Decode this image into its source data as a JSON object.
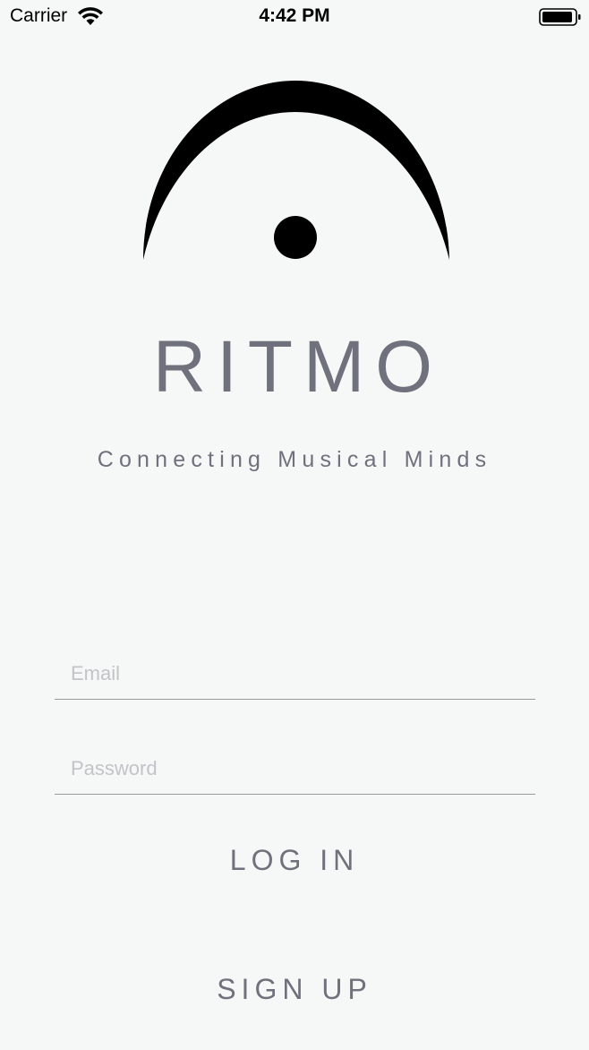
{
  "status_bar": {
    "carrier": "Carrier",
    "time": "4:42 PM",
    "wifi_icon": "wifi-icon",
    "battery_icon": "battery-icon"
  },
  "logo": {
    "icon": "fermata-icon"
  },
  "app_name": "RITMO",
  "tagline": "Connecting Musical Minds",
  "form": {
    "email_placeholder": "Email",
    "email_value": "",
    "password_placeholder": "Password",
    "password_value": ""
  },
  "buttons": {
    "login_label": "LOG IN",
    "signup_label": "SIGN UP"
  },
  "colors": {
    "background": "#f6f7f7",
    "text_accent": "#6f717d",
    "placeholder": "#c4c4c8",
    "divider": "#9a9a9a"
  }
}
